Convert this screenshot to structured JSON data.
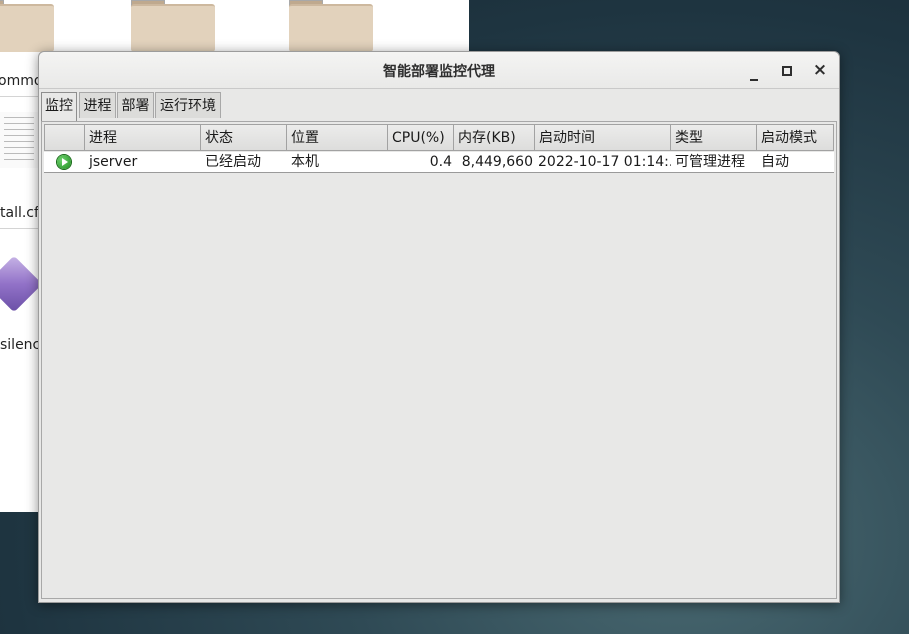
{
  "desktop": {
    "file_labels": [
      "ommon",
      "tall.cf",
      "silenc"
    ]
  },
  "window": {
    "title": "智能部署监控代理",
    "controls": {
      "minimize": "minimize-icon",
      "maximize": "maximize-icon",
      "close": "×"
    }
  },
  "tabs": [
    {
      "label": "监控",
      "active": true
    },
    {
      "label": "进程",
      "active": false
    },
    {
      "label": "部署",
      "active": false
    },
    {
      "label": "运行环境",
      "active": false
    }
  ],
  "table": {
    "columns": [
      "",
      "进程",
      "状态",
      "位置",
      "CPU(%)",
      "内存(KB)",
      "启动时间",
      "类型",
      "启动模式"
    ],
    "rows": [
      {
        "status_icon": "play-icon",
        "process": "jserver",
        "state": "已经启动",
        "location": "本机",
        "cpu": "0.4",
        "memory": "8,449,660",
        "start_time": "2022-10-17 01:14:...",
        "type": "可管理进程",
        "start_mode": "自动"
      }
    ]
  },
  "colors": {
    "status_running": "#2ea82e",
    "window_bg": "#e8e8e7",
    "desktop_bg": "#2f4a55"
  }
}
